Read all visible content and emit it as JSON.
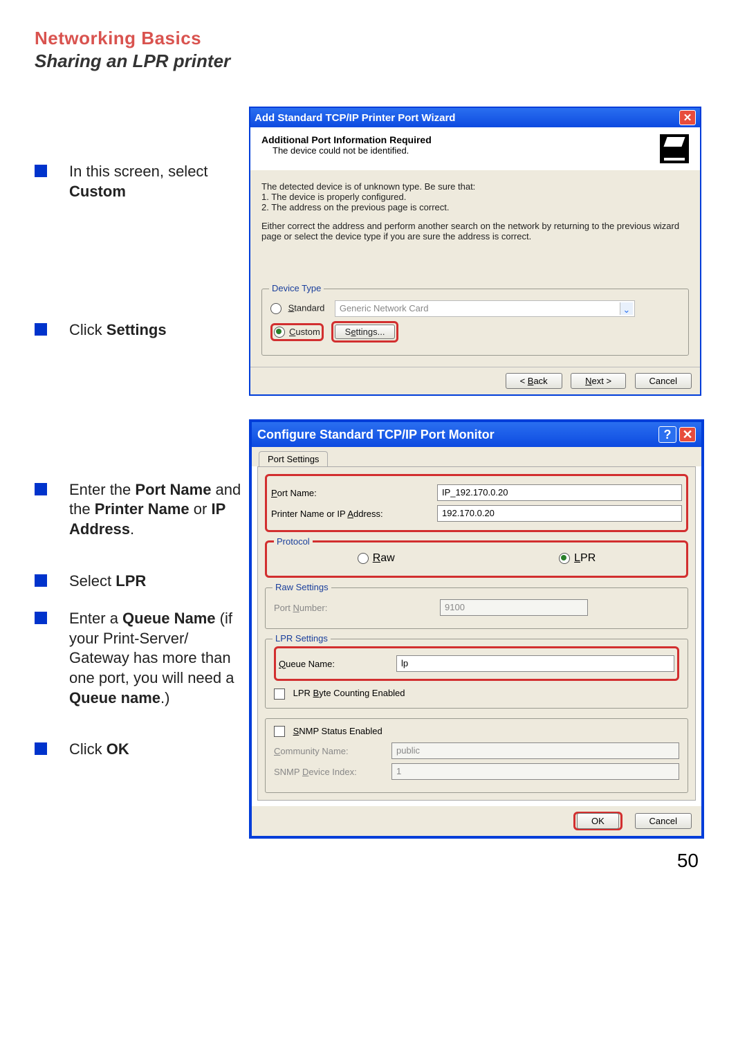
{
  "header": {
    "title": "Networking Basics",
    "subtitle": "Sharing an LPR printer"
  },
  "instructions": {
    "i1a": "In this screen, select ",
    "i1b": "Custom",
    "i2a": "Click ",
    "i2b": "Settings",
    "i3": "Enter the <b>Port Name</b> and the <b>Printer Name</b> or <b>IP Address</b>.",
    "i4a": "Select ",
    "i4b": "LPR",
    "i5": "Enter a <b>Queue Name</b> (if your Print-Server/ Gateway has more than one port, you will need a <b>Queue name</b>.)",
    "i6a": "Click ",
    "i6b": "OK"
  },
  "wizard1": {
    "title": "Add Standard TCP/IP Printer Port Wizard",
    "sub_title": "Additional Port Information Required",
    "sub_desc": "The device could not be identified.",
    "body_line1": "The detected device is of unknown type.  Be sure that:",
    "body_bullet1": "1. The device is properly configured.",
    "body_bullet2": "2.  The address on the previous page is correct.",
    "body_para2": "Either correct the address and perform another search on the network by returning to the previous wizard page or select the device type if you are sure the address is correct.",
    "fs_legend": "Device Type",
    "opt_standard": "Standard",
    "opt_custom": "Custom",
    "dd_value": "Generic Network Card",
    "settings_btn": "Settings...",
    "back": "< Back",
    "next": "Next >",
    "cancel": "Cancel"
  },
  "dialog2": {
    "title": "Configure Standard TCP/IP Port Monitor",
    "tab": "Port Settings",
    "port_name_lbl": "Port Name:",
    "port_name_val": "IP_192.170.0.20",
    "ip_lbl": "Printer Name or IP Address:",
    "ip_val": "192.170.0.20",
    "protocol_legend": "Protocol",
    "proto_raw": "Raw",
    "proto_lpr": "LPR",
    "raw_legend": "Raw Settings",
    "raw_port_lbl": "Port Number:",
    "raw_port_val": "9100",
    "lpr_legend": "LPR Settings",
    "queue_lbl": "Queue Name:",
    "queue_val": "lp",
    "lpr_byte": "LPR Byte Counting Enabled",
    "snmp_chk": "SNMP Status Enabled",
    "comm_lbl": "Community Name:",
    "comm_val": "public",
    "snmp_idx_lbl": "SNMP Device Index:",
    "snmp_idx_val": "1",
    "ok": "OK",
    "cancel": "Cancel"
  },
  "page_number": "50"
}
